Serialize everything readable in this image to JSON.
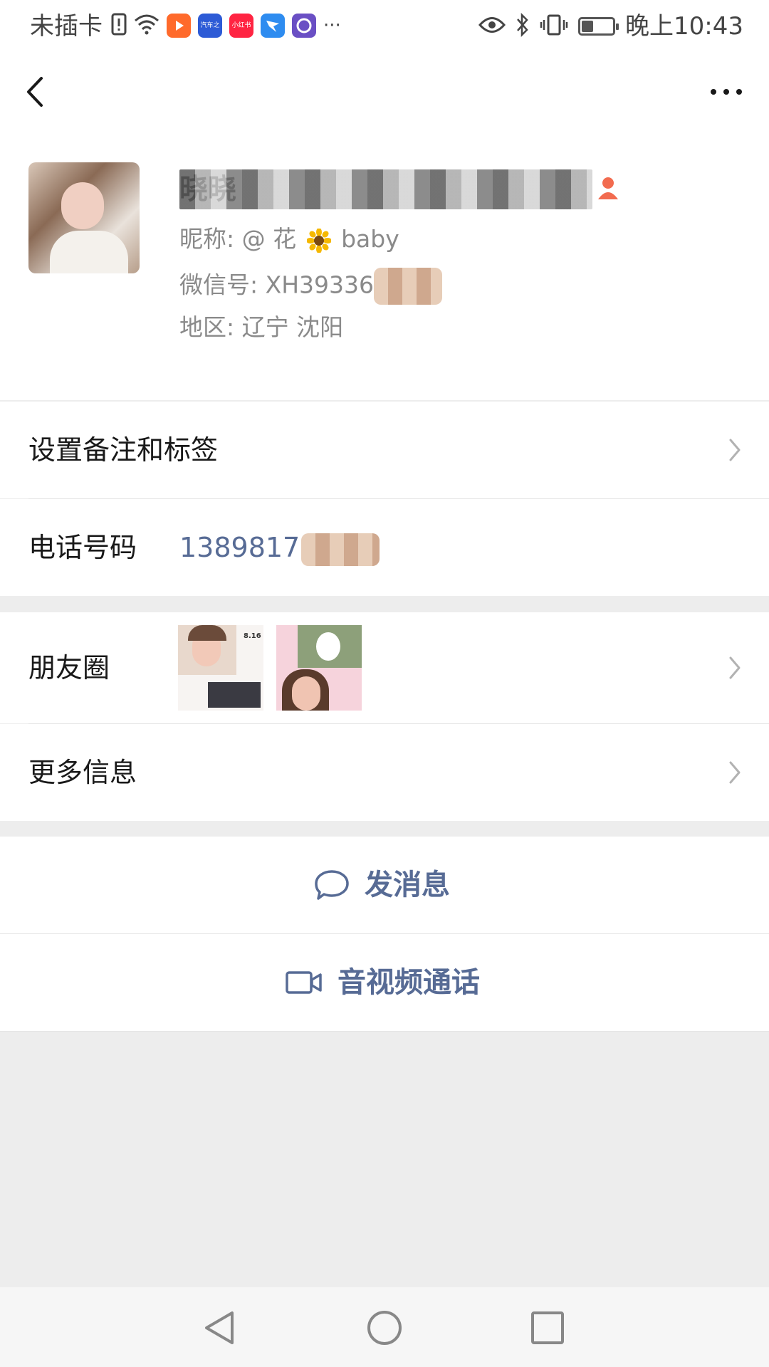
{
  "status_bar": {
    "carrier": "未插卡",
    "time": "晚上10:43",
    "battery_level": 0.35,
    "app_icons": [
      {
        "name": "video-app-icon",
        "color": "#ff6a2b",
        "label": ""
      },
      {
        "name": "autohome-app-icon",
        "color": "#2d5bd6",
        "label": "汽车之家"
      },
      {
        "name": "xiaohongshu-app-icon",
        "color": "#ff2442",
        "label": "小红书"
      },
      {
        "name": "dingtalk-app-icon",
        "color": "#2e8cf0",
        "label": ""
      },
      {
        "name": "misc-app-icon",
        "color": "#6a4fc4",
        "label": ""
      }
    ],
    "more": "···"
  },
  "nav": {
    "back_icon": "chevron-left-icon",
    "more_icon": "more-horizontal-icon"
  },
  "profile": {
    "name": "晓晓",
    "nickname_prefix": "昵称: @ 花",
    "nickname_suffix": "baby",
    "wechat_id_label": "微信号: XH39336",
    "region_label": "地区: 辽宁 沈阳"
  },
  "rows": {
    "remark_label": "设置备注和标签",
    "phone_label": "电话号码",
    "phone_value": "1389817",
    "moments_label": "朋友圈",
    "more_info_label": "更多信息"
  },
  "moments": {
    "thumb1_caption": "8.16"
  },
  "actions": {
    "message_label": "发消息",
    "call_label": "音视频通话"
  },
  "colors": {
    "link": "#576b95",
    "background": "#ededed"
  }
}
